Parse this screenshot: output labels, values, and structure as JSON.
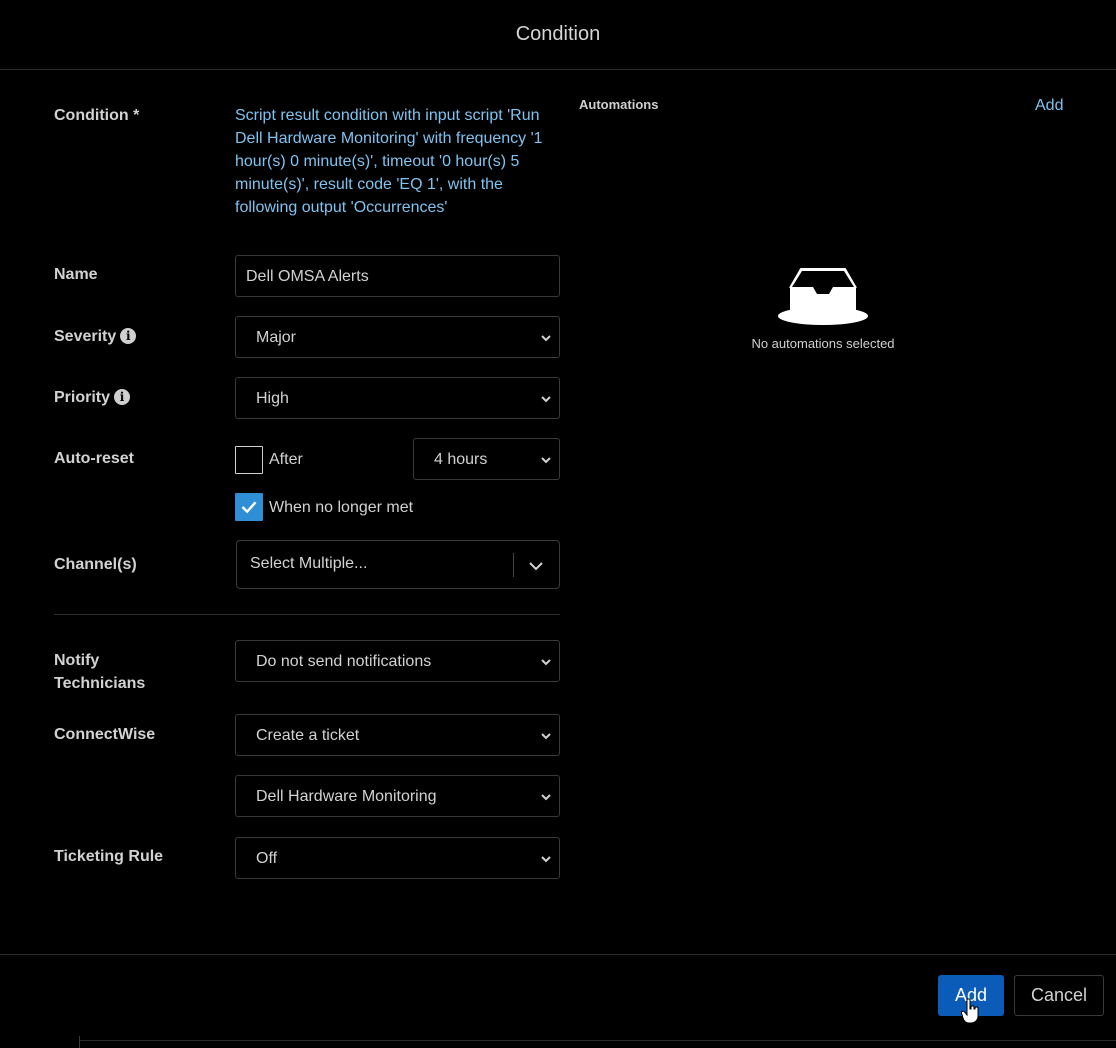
{
  "header": {
    "title": "Condition"
  },
  "form": {
    "condition_label": "Condition *",
    "condition_text": "Script result condition with input script 'Run Dell Hardware Monitoring' with frequency '1 hour(s) 0 minute(s)', timeout '0 hour(s) 5 minute(s)', result code 'EQ 1', with the following output 'Occurrences'",
    "name_label": "Name",
    "name_value": "Dell OMSA Alerts",
    "severity_label": "Severity",
    "severity_value": "Major",
    "priority_label": "Priority",
    "priority_value": "High",
    "autoreset_label": "Auto-reset",
    "after_label": "After",
    "after_value": "4 hours",
    "when_label": "When no longer met",
    "channels_label": "Channel(s)",
    "channels_placeholder": "Select Multiple...",
    "notify_label_line1": "Notify",
    "notify_label_line2": "Technicians",
    "notify_value": "Do not send notifications",
    "connectwise_label": "ConnectWise",
    "connectwise_value": "Create a ticket",
    "connectwise_board": "Dell Hardware Monitoring",
    "ticketing_label": "Ticketing Rule",
    "ticketing_value": "Off"
  },
  "automations": {
    "title": "Automations",
    "add_label": "Add",
    "empty_text": "No automations selected",
    "empty_icon": "inbox-tray-icon"
  },
  "footer": {
    "add_label": "Add",
    "cancel_label": "Cancel"
  },
  "colors": {
    "accent": "#0b5bb8",
    "link": "#7fc3f0",
    "checkbox": "#2e8fd6",
    "background": "#000000"
  }
}
